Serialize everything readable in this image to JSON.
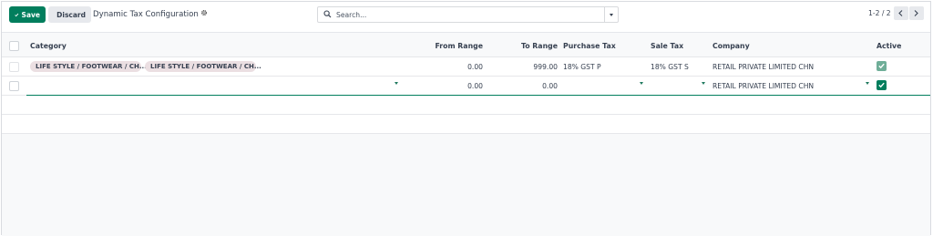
{
  "toolbar": {
    "save_label": "Save",
    "discard_label": "Discard",
    "title": "Dynamic Tax Configuration",
    "search_placeholder": "Search...",
    "pager": "1-2 / 2"
  },
  "table": {
    "columns": [
      "Category",
      "From Range",
      "To Range",
      "Purchase Tax",
      "Sale Tax",
      "Company",
      "Active"
    ],
    "rows": [
      {
        "tags": [
          "LIFE STYLE / FOOTWEAR / CH...",
          "LIFE STYLE / FOOTWEAR / CH..."
        ],
        "from_range": "0.00",
        "to_range": "999.00",
        "purchase_tax": "18% GST P",
        "sale_tax": "18% GST S",
        "company": "RETAIL PRIVATE LIMITED CHN",
        "active": true
      },
      {
        "tags": [],
        "from_range": "0.00",
        "to_range": "0.00",
        "purchase_tax": "",
        "sale_tax": "",
        "company": "RETAIL PRIVATE LIMITED CHN",
        "active": true
      }
    ]
  },
  "colors": {
    "primary": "#017e5d",
    "tag_bg": "#ebdfe2",
    "secondary_btn": "#e7e9ed"
  },
  "icons": [
    "check-icon",
    "undo-icon",
    "gear-icon",
    "search-icon",
    "caret-down-icon",
    "chevron-left-icon",
    "chevron-right-icon"
  ]
}
